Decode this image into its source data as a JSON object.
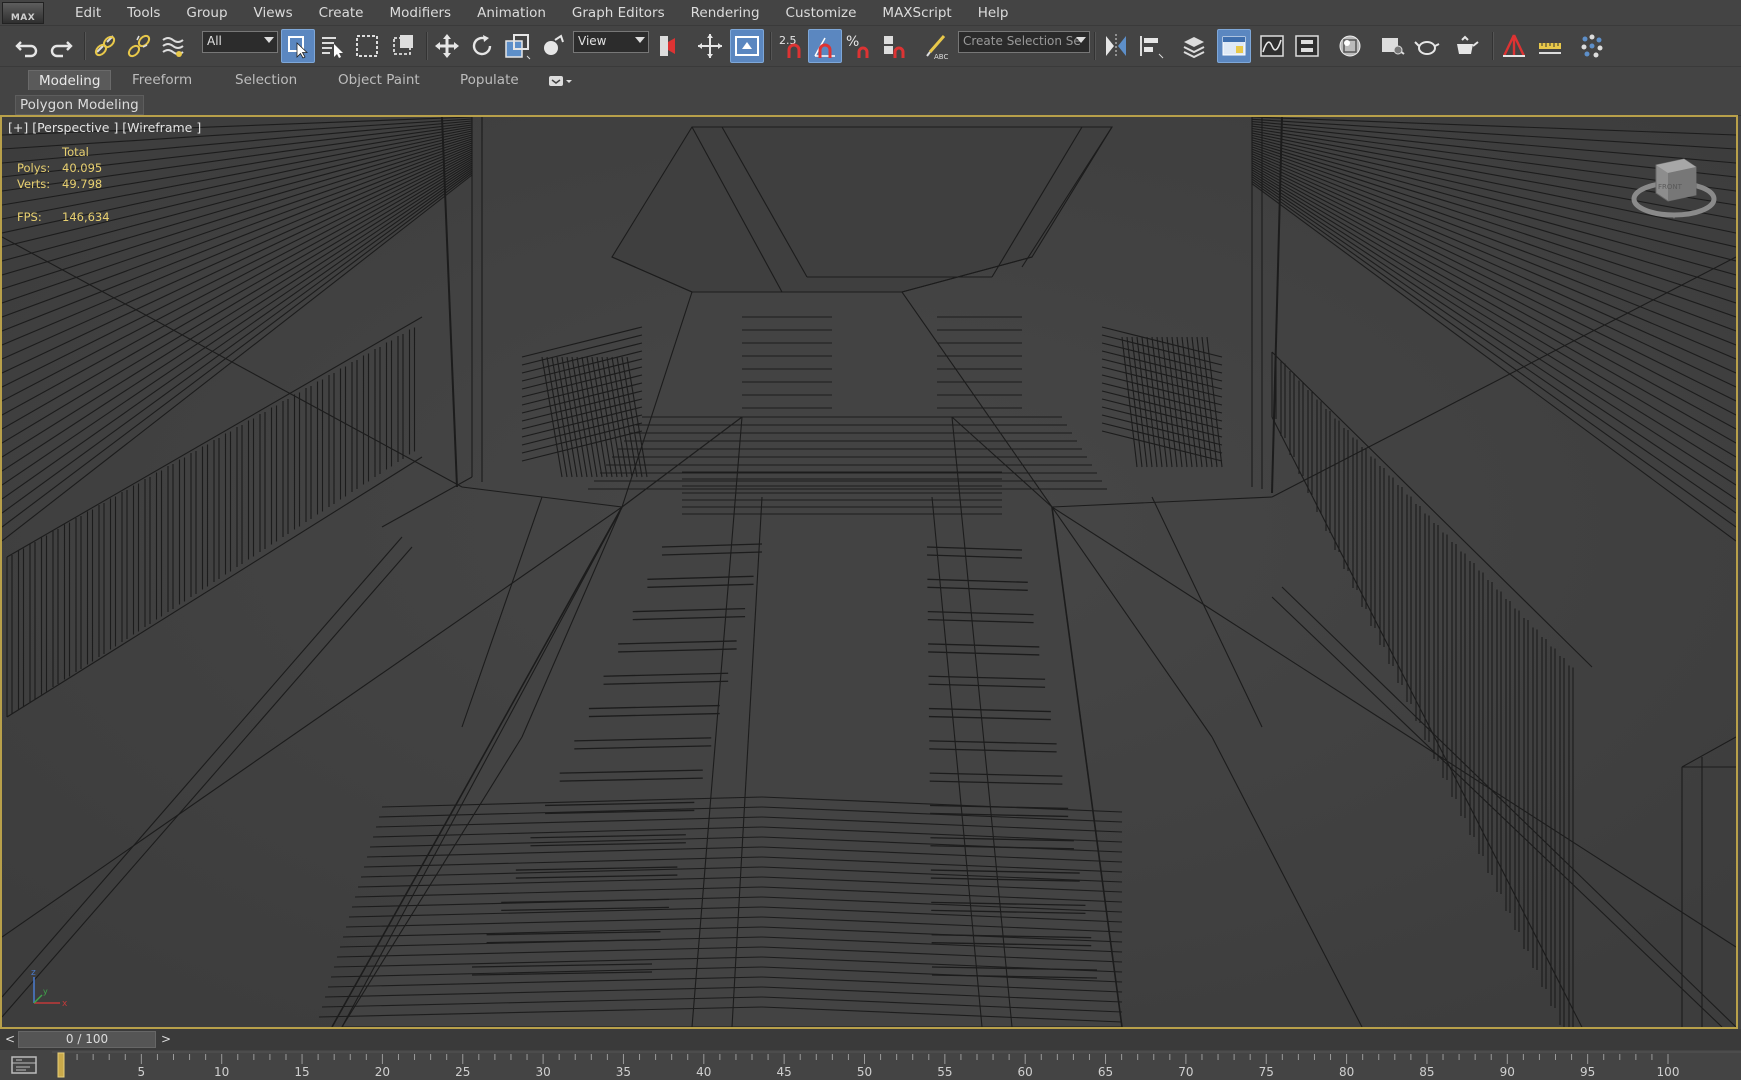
{
  "app": {
    "logo_text": "MAX"
  },
  "menu": [
    "Edit",
    "Tools",
    "Group",
    "Views",
    "Create",
    "Modifiers",
    "Animation",
    "Graph Editors",
    "Rendering",
    "Customize",
    "MAXScript",
    "Help"
  ],
  "toolbar": {
    "selection_filter": "All",
    "reference_coord_system": "View",
    "snap_value": "2.5",
    "named_selection_set_placeholder": "Create Selection Se"
  },
  "ribbon": {
    "tabs": [
      "Modeling",
      "Freeform",
      "Selection",
      "Object Paint",
      "Populate"
    ],
    "active_tab": "Modeling",
    "panel_label": "Polygon Modeling"
  },
  "viewport": {
    "label": "[+] [Perspective ] [Wireframe ]",
    "stats": {
      "header": "Total",
      "polys_label": "Polys:",
      "polys_value": "40.095",
      "verts_label": "Verts:",
      "verts_value": "49.798",
      "fps_label": "FPS:",
      "fps_value": "146,634"
    },
    "viewcube_label": "FRONT",
    "axis": {
      "z": "z",
      "y": "y",
      "x": "x"
    }
  },
  "timeline": {
    "prev": "<",
    "next": ">",
    "frame_display": "0 / 100",
    "ticks": [
      "5",
      "10",
      "15",
      "20",
      "25",
      "30",
      "35",
      "40",
      "45",
      "50",
      "55",
      "60",
      "65",
      "70",
      "75",
      "80",
      "85",
      "90",
      "95",
      "100"
    ]
  },
  "colors": {
    "viewport_border": "#b8a04a",
    "active_tool": "#5b87c0",
    "stats_text": "#e8d070",
    "snap_icon": "#4aa3e0"
  }
}
